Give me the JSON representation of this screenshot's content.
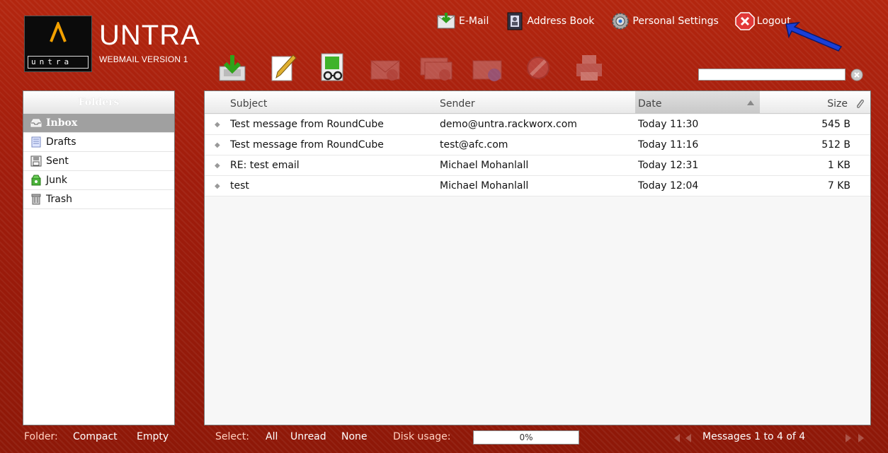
{
  "brand": {
    "logo_title": "UNTRA",
    "logo_subtitle": "WEBMAIL VERSION 1",
    "logo_small": "untra"
  },
  "topnav": {
    "items": [
      {
        "label": "E-Mail",
        "icon": "mail-download-icon"
      },
      {
        "label": "Address Book",
        "icon": "address-book-icon"
      },
      {
        "label": "Personal Settings",
        "icon": "settings-gear-icon"
      },
      {
        "label": "Logout",
        "icon": "logout-x-icon"
      }
    ]
  },
  "toolbar": {
    "buttons": [
      {
        "name": "check-mail",
        "icon": "inbox-download-icon",
        "enabled": true
      },
      {
        "name": "compose",
        "icon": "pencil-icon",
        "enabled": true
      },
      {
        "name": "address-lookup",
        "icon": "contact-glasses-icon",
        "enabled": true
      },
      {
        "name": "reply",
        "icon": "reply-icon",
        "enabled": false
      },
      {
        "name": "reply-all",
        "icon": "reply-all-icon",
        "enabled": false
      },
      {
        "name": "forward",
        "icon": "forward-icon",
        "enabled": false
      },
      {
        "name": "delete",
        "icon": "no-entry-icon",
        "enabled": false
      },
      {
        "name": "print",
        "icon": "printer-icon",
        "enabled": false
      }
    ]
  },
  "search": {
    "value": ""
  },
  "folders": {
    "header": "Folders",
    "items": [
      {
        "label": "Inbox",
        "icon": "inbox-icon",
        "selected": true
      },
      {
        "label": "Drafts",
        "icon": "drafts-icon",
        "selected": false
      },
      {
        "label": "Sent",
        "icon": "sent-icon",
        "selected": false
      },
      {
        "label": "Junk",
        "icon": "junk-icon",
        "selected": false
      },
      {
        "label": "Trash",
        "icon": "trash-icon",
        "selected": false
      }
    ]
  },
  "messages": {
    "columns": {
      "subject": "Subject",
      "sender": "Sender",
      "date": "Date",
      "size": "Size"
    },
    "sorted_by": "date",
    "rows": [
      {
        "subject": "Test message from RoundCube",
        "sender": "demo@untra.rackworx.com",
        "date": "Today 11:30",
        "size": "545 B"
      },
      {
        "subject": "Test message from RoundCube",
        "sender": "test@afc.com",
        "date": "Today 11:16",
        "size": "512 B"
      },
      {
        "subject": "RE: test email",
        "sender": "Michael Mohanlall",
        "date": "Today 12:31",
        "size": "1 KB"
      },
      {
        "subject": "test",
        "sender": "Michael Mohanlall",
        "date": "Today 12:04",
        "size": "7 KB"
      }
    ]
  },
  "footer": {
    "folder_label": "Folder:",
    "compact": "Compact",
    "empty": "Empty",
    "select_label": "Select:",
    "select_all": "All",
    "select_unread": "Unread",
    "select_none": "None",
    "disk_label": "Disk usage:",
    "disk_value": "0%",
    "pager_text": "Messages 1 to 4 of 4"
  },
  "colors": {
    "background": "#a8200f",
    "annotation_arrow": "#1a3fd8",
    "selected_folder": "#a0a0a0"
  }
}
